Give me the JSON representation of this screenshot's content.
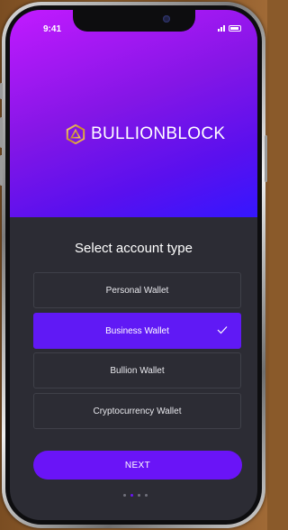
{
  "status_bar": {
    "time": "9:41"
  },
  "brand": {
    "name": "BULLIONBLOCK"
  },
  "title": "Select account type",
  "options": [
    {
      "label": "Personal Wallet",
      "selected": false
    },
    {
      "label": "Business Wallet",
      "selected": true
    },
    {
      "label": "Bullion Wallet",
      "selected": false
    },
    {
      "label": "Cryptocurrency Wallet",
      "selected": false
    }
  ],
  "next_label": "NEXT",
  "pagination": {
    "total": 4,
    "active_index": 1
  },
  "colors": {
    "accent": "#6a14f7",
    "hero_start": "#c21aff",
    "hero_end": "#3516ff",
    "screen_bg": "#2c2c34"
  }
}
